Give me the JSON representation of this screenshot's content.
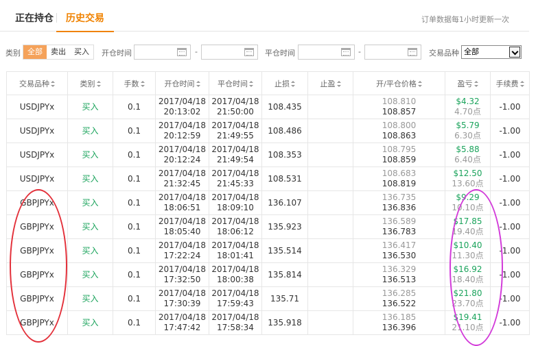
{
  "tabs": {
    "current": "正在持仓",
    "history": "历史交易"
  },
  "update_note": "订单数据每1小时更新一次",
  "filter": {
    "type_label": "类别",
    "type_options": [
      "全部",
      "卖出",
      "买入"
    ],
    "open_time_label": "开仓时间",
    "close_time_label": "平仓时间",
    "dash": "-",
    "product_label": "交易品种",
    "product_selected": "全部"
  },
  "table": {
    "headers": [
      "交易品种",
      "类别",
      "手数",
      "开仓时间",
      "平仓时间",
      "止损",
      "止盈",
      "开/平仓价格",
      "盈亏",
      "手续费"
    ],
    "rows": [
      {
        "symbol": "USDJPYx",
        "type": "买入",
        "lots": "0.1",
        "open_date": "2017/04/18",
        "open_time": "20:13:02",
        "close_date": "2017/04/18",
        "close_time": "21:50:00",
        "sl": "108.435",
        "tp": "",
        "open_price": "108.810",
        "close_price": "108.857",
        "pnl": "$4.32",
        "points": "4.70点",
        "fee": "-1.00"
      },
      {
        "symbol": "USDJPYx",
        "type": "买入",
        "lots": "0.1",
        "open_date": "2017/04/18",
        "open_time": "20:12:59",
        "close_date": "2017/04/18",
        "close_time": "21:49:55",
        "sl": "108.486",
        "tp": "",
        "open_price": "108.800",
        "close_price": "108.863",
        "pnl": "$5.79",
        "points": "6.30点",
        "fee": "-1.00"
      },
      {
        "symbol": "USDJPYx",
        "type": "买入",
        "lots": "0.1",
        "open_date": "2017/04/18",
        "open_time": "20:12:24",
        "close_date": "2017/04/18",
        "close_time": "21:49:54",
        "sl": "108.353",
        "tp": "",
        "open_price": "108.795",
        "close_price": "108.859",
        "pnl": "$5.88",
        "points": "6.40点",
        "fee": "-1.00"
      },
      {
        "symbol": "USDJPYx",
        "type": "买入",
        "lots": "0.1",
        "open_date": "2017/04/18",
        "open_time": "21:32:45",
        "close_date": "2017/04/18",
        "close_time": "21:45:33",
        "sl": "108.531",
        "tp": "",
        "open_price": "108.683",
        "close_price": "108.819",
        "pnl": "$12.50",
        "points": "13.60点",
        "fee": "-1.00"
      },
      {
        "symbol": "GBPJPYx",
        "type": "买入",
        "lots": "0.1",
        "open_date": "2017/04/18",
        "open_time": "18:06:51",
        "close_date": "2017/04/18",
        "close_time": "18:09:10",
        "sl": "136.107",
        "tp": "",
        "open_price": "136.735",
        "close_price": "136.836",
        "pnl": "$9.29",
        "points": "10.10点",
        "fee": "-1.00"
      },
      {
        "symbol": "GBPJPYx",
        "type": "买入",
        "lots": "0.1",
        "open_date": "2017/04/18",
        "open_time": "18:05:40",
        "close_date": "2017/04/18",
        "close_time": "18:06:12",
        "sl": "135.923",
        "tp": "",
        "open_price": "136.589",
        "close_price": "136.783",
        "pnl": "$17.85",
        "points": "19.40点",
        "fee": "-1.00"
      },
      {
        "symbol": "GBPJPYx",
        "type": "买入",
        "lots": "0.1",
        "open_date": "2017/04/18",
        "open_time": "17:22:24",
        "close_date": "2017/04/18",
        "close_time": "18:01:41",
        "sl": "135.514",
        "tp": "",
        "open_price": "136.417",
        "close_price": "136.530",
        "pnl": "$10.40",
        "points": "11.30点",
        "fee": "-1.00"
      },
      {
        "symbol": "GBPJPYx",
        "type": "买入",
        "lots": "0.1",
        "open_date": "2017/04/18",
        "open_time": "17:32:50",
        "close_date": "2017/04/18",
        "close_time": "18:00:38",
        "sl": "135.814",
        "tp": "",
        "open_price": "136.329",
        "close_price": "136.513",
        "pnl": "$16.92",
        "points": "18.40点",
        "fee": "-1.00"
      },
      {
        "symbol": "GBPJPYx",
        "type": "买入",
        "lots": "0.1",
        "open_date": "2017/04/18",
        "open_time": "17:30:39",
        "close_date": "2017/04/18",
        "close_time": "17:59:43",
        "sl": "135.71",
        "tp": "",
        "open_price": "136.285",
        "close_price": "136.522",
        "pnl": "$21.80",
        "points": "23.70点",
        "fee": "-1.00"
      },
      {
        "symbol": "GBPJPYx",
        "type": "买入",
        "lots": "0.1",
        "open_date": "2017/04/18",
        "open_time": "17:47:42",
        "close_date": "2017/04/18",
        "close_time": "17:58:34",
        "sl": "135.918",
        "tp": "",
        "open_price": "136.185",
        "close_price": "136.396",
        "pnl": "$19.41",
        "points": "21.10点",
        "fee": "-1.00"
      }
    ]
  },
  "colors": {
    "accent": "#f08200",
    "profit": "#1aa35b",
    "annotation_red": "#e3303a",
    "annotation_magenta": "#d23ad9"
  }
}
